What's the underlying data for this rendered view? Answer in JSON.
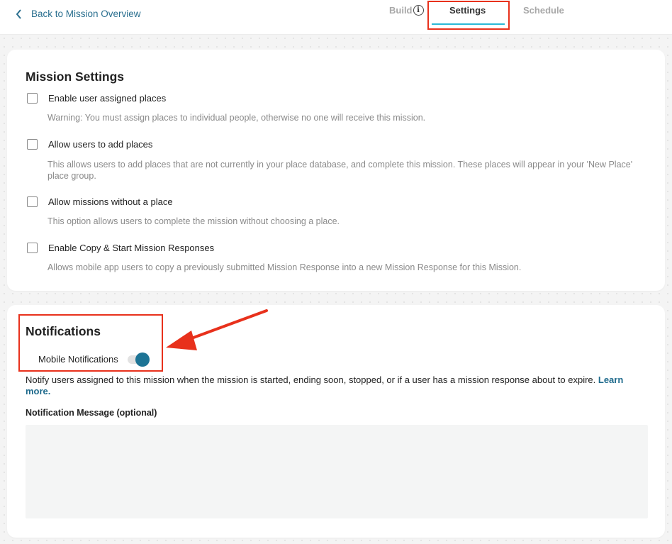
{
  "header": {
    "back_label": "Back to Mission Overview",
    "tabs": [
      {
        "label": "Build",
        "active": false
      },
      {
        "label": "Settings",
        "active": true
      },
      {
        "label": "Schedule",
        "active": false
      }
    ]
  },
  "mission_settings": {
    "title": "Mission Settings",
    "options": [
      {
        "label": "Enable user assigned places",
        "checked": false,
        "description": "Warning: You must assign places to individual people, otherwise no one will receive this mission."
      },
      {
        "label": "Allow users to add places",
        "checked": false,
        "description": "This allows users to add places that are not currently in your place database, and complete this mission. These places will appear in your 'New Place' place group."
      },
      {
        "label": "Allow missions without a place",
        "checked": false,
        "description": "This option allows users to complete the mission without choosing a place."
      },
      {
        "label": "Enable Copy & Start Mission Responses",
        "checked": false,
        "description": "Allows mobile app users to copy a previously submitted Mission Response into a new Mission Response for this Mission."
      }
    ]
  },
  "notifications": {
    "title": "Notifications",
    "toggle_label": "Mobile Notifications",
    "toggle_on": true,
    "description": "Notify users assigned to this mission when the mission is started, ending soon, stopped, or if a user has a mission response about to expire.",
    "learn_more": "Learn more.",
    "message_label": "Notification Message (optional)",
    "message_value": "",
    "message_placeholder": ""
  },
  "colors": {
    "accent": "#2bb8d6",
    "link": "#1e6a8c",
    "toggle_on": "#1d7495",
    "annotation": "#e8311c"
  }
}
